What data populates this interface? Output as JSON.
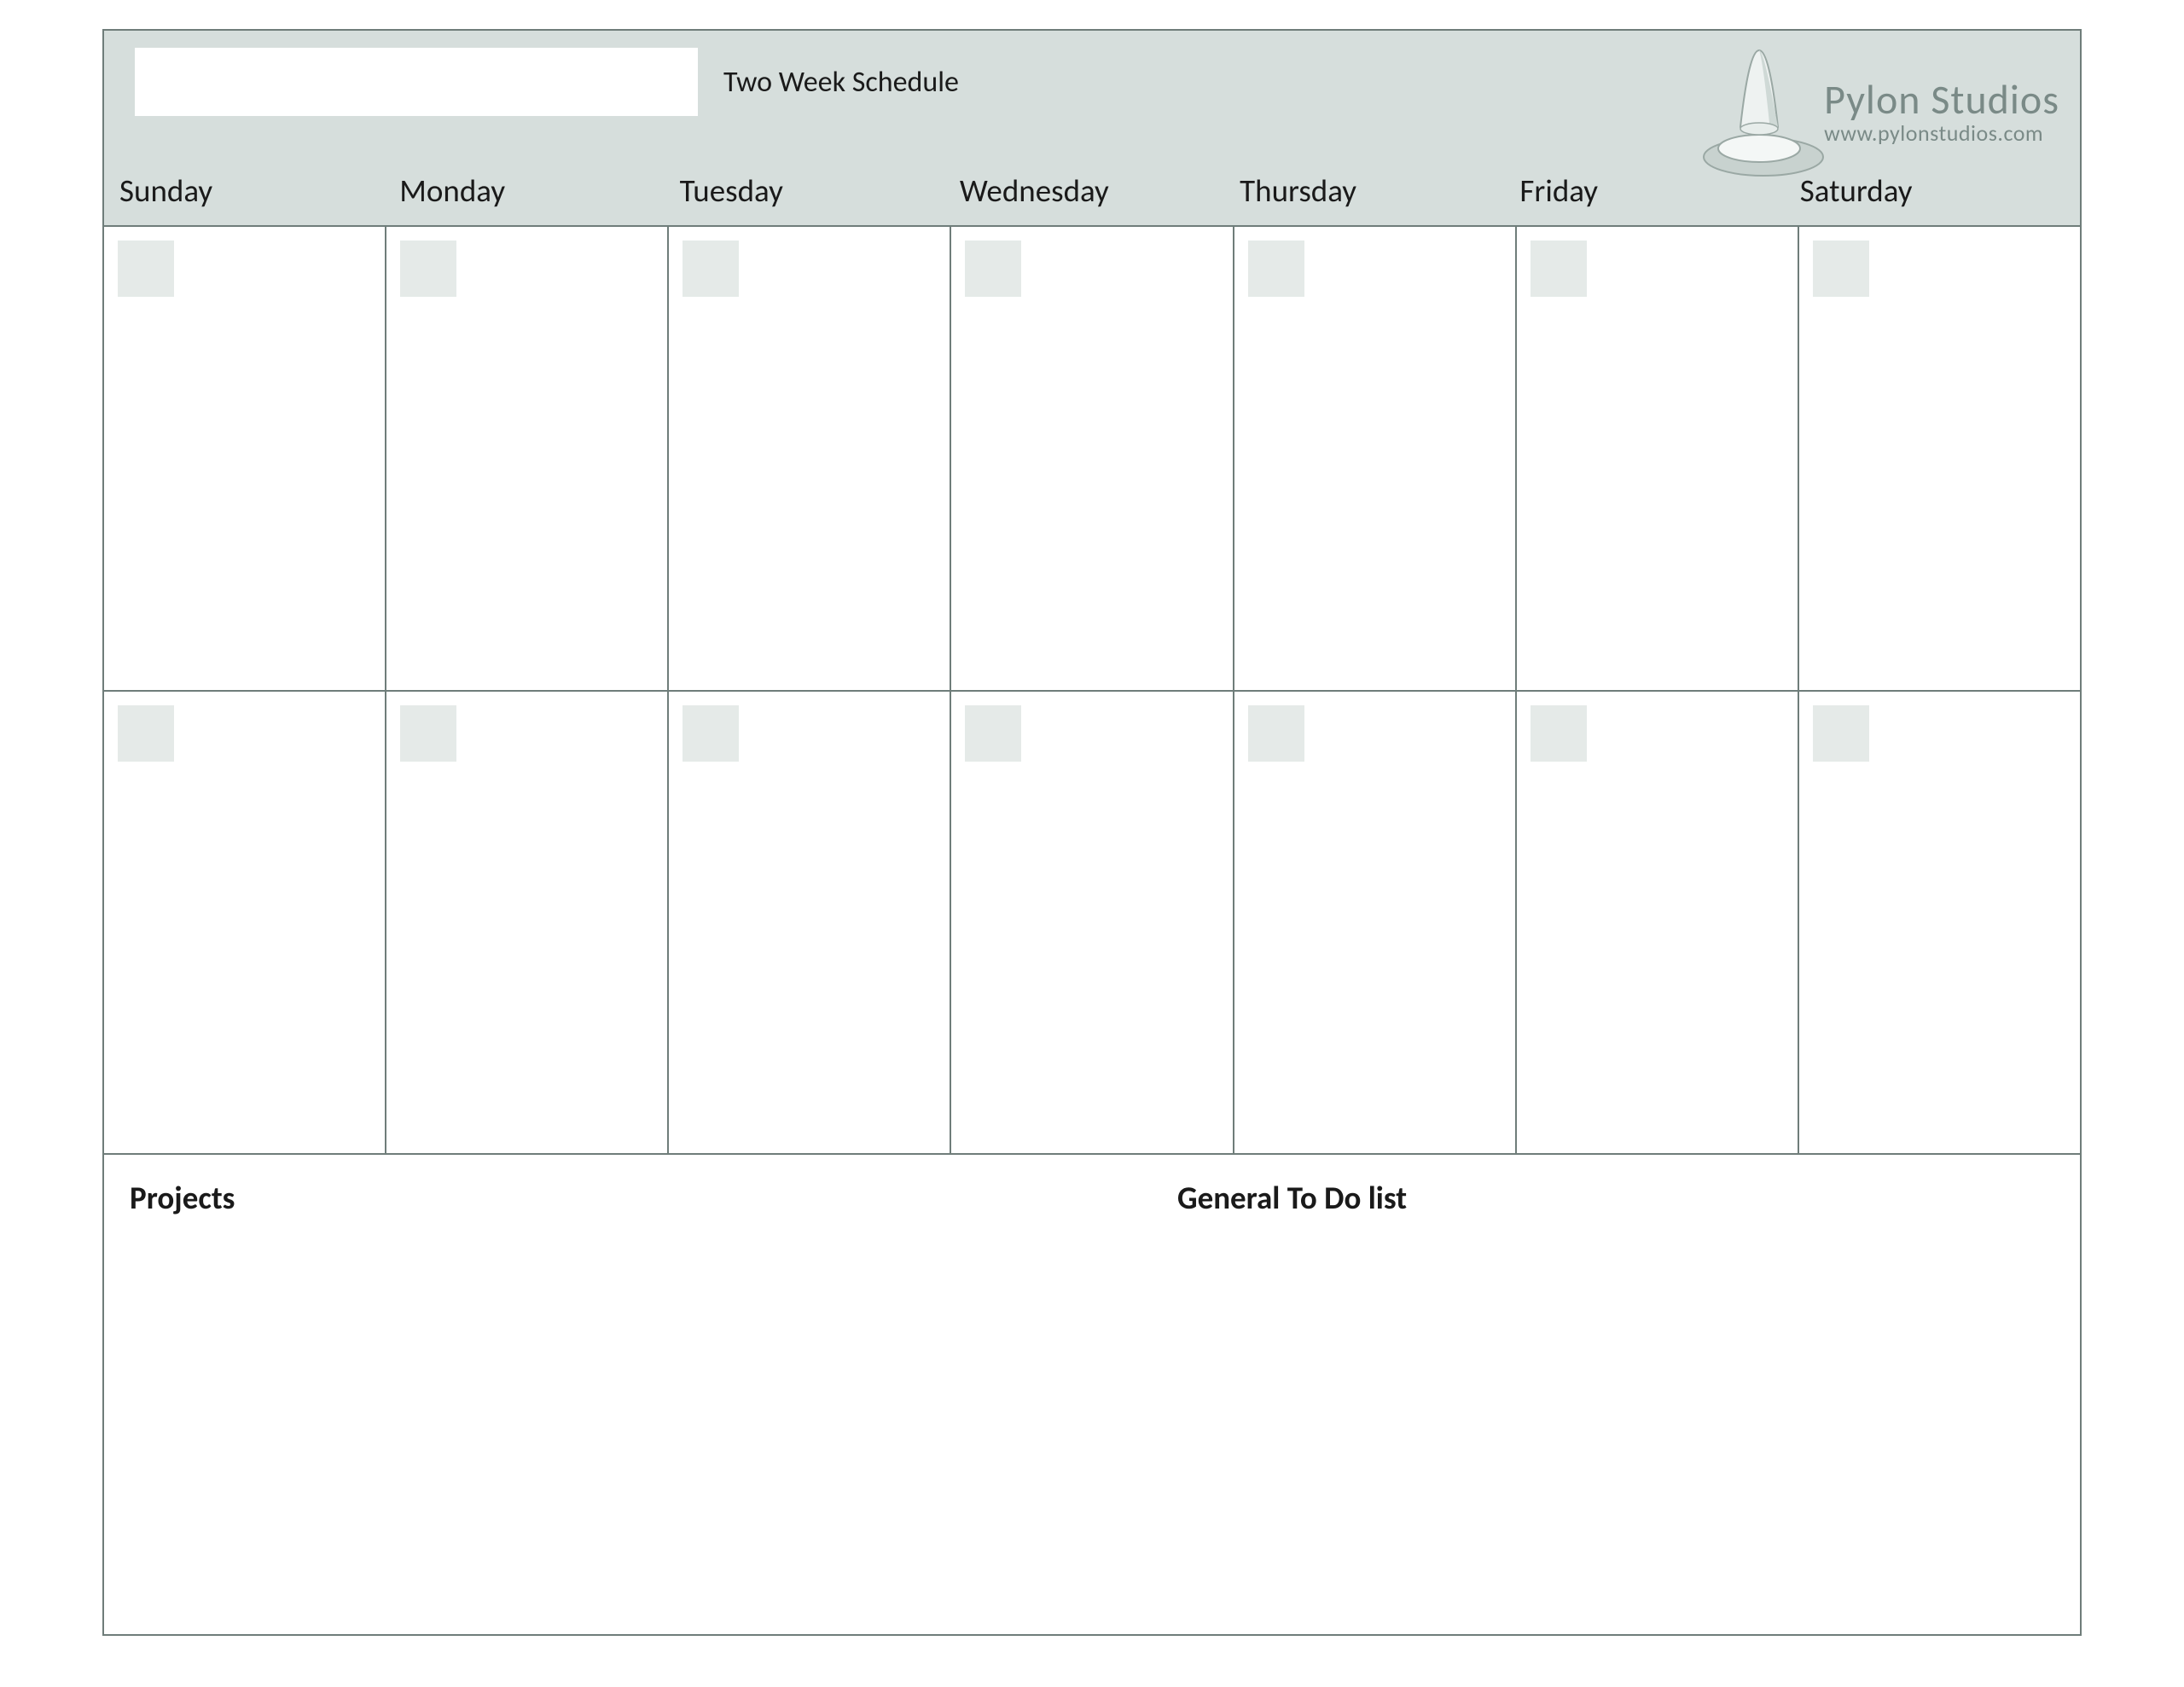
{
  "header": {
    "title_input_value": "",
    "subtitle": "Two Week Schedule"
  },
  "logo": {
    "name": "Pylon Studios",
    "url": "www.pylonstudios.com"
  },
  "days": [
    "Sunday",
    "Monday",
    "Tuesday",
    "Wednesday",
    "Thursday",
    "Friday",
    "Saturday"
  ],
  "weeks": [
    {
      "cells": [
        {
          "date": ""
        },
        {
          "date": ""
        },
        {
          "date": ""
        },
        {
          "date": ""
        },
        {
          "date": ""
        },
        {
          "date": ""
        },
        {
          "date": ""
        }
      ]
    },
    {
      "cells": [
        {
          "date": ""
        },
        {
          "date": ""
        },
        {
          "date": ""
        },
        {
          "date": ""
        },
        {
          "date": ""
        },
        {
          "date": ""
        },
        {
          "date": ""
        }
      ]
    }
  ],
  "footer": {
    "projects_label": "Projects",
    "todo_label": "General To Do list"
  }
}
